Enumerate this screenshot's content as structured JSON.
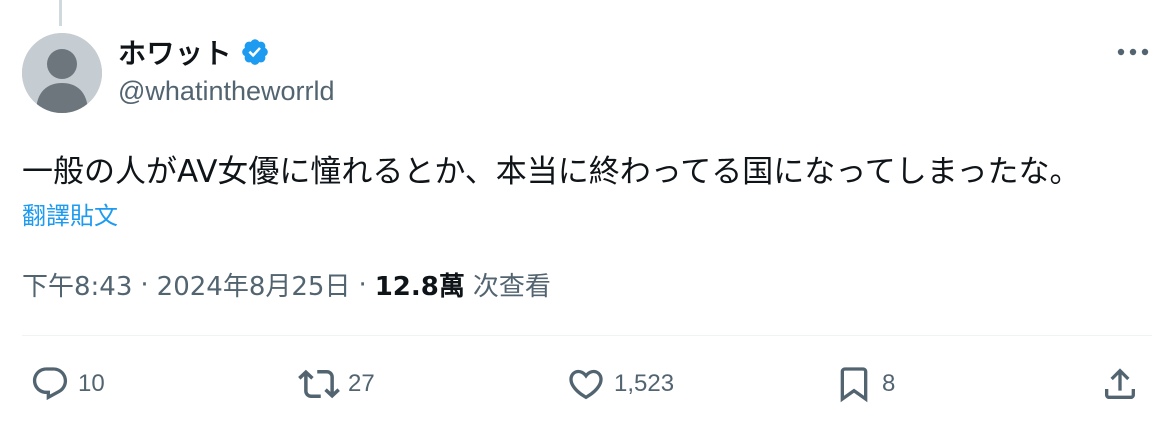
{
  "tweet": {
    "display_name": "ホワット",
    "handle": "@whatintheworrld",
    "text": "一般の人がAV女優に憧れるとか、本当に終わってる国になってしまったな。",
    "translate_label": "翻譯貼文",
    "time": "下午8:43",
    "separator_1": "·",
    "date": "2024年8月25日",
    "separator_2": "·",
    "views_count": "12.8萬",
    "views_label": "次查看"
  },
  "actions": {
    "reply_count": "10",
    "retweet_count": "27",
    "like_count": "1,523",
    "bookmark_count": "8"
  },
  "icons": {
    "verified": "verified-badge-icon",
    "more": "more-icon",
    "reply": "reply-icon",
    "retweet": "retweet-icon",
    "like": "heart-icon",
    "bookmark": "bookmark-icon",
    "share": "share-icon"
  },
  "colors": {
    "accent": "#1d9bf0",
    "text_primary": "#0f1419",
    "text_secondary": "#536471",
    "divider": "#eff3f4"
  }
}
